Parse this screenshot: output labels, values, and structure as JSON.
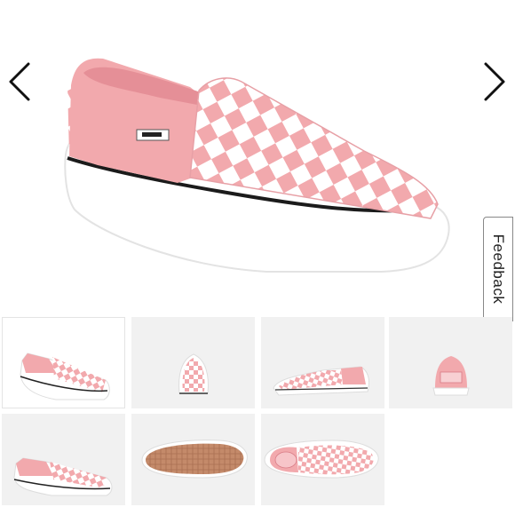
{
  "gallery": {
    "main_image": "pink-checkerboard-slip-on-sneaker",
    "prev_icon": "chevron-left-icon",
    "next_icon": "chevron-right-icon",
    "thumbnails": [
      {
        "view": "side-view",
        "selected": true
      },
      {
        "view": "front-view",
        "selected": false
      },
      {
        "view": "inner-side-view",
        "selected": false
      },
      {
        "view": "back-view",
        "selected": false
      },
      {
        "view": "outer-side-view",
        "selected": false
      },
      {
        "view": "outsole-view",
        "selected": false
      },
      {
        "view": "top-view",
        "selected": false
      }
    ]
  },
  "feedback": {
    "label": "Feedback"
  },
  "colors": {
    "accent_pink": "#f2a9ad",
    "checker_white": "#ffffff",
    "sole": "#ffffff",
    "thumb_bg": "#f1f1f1"
  }
}
